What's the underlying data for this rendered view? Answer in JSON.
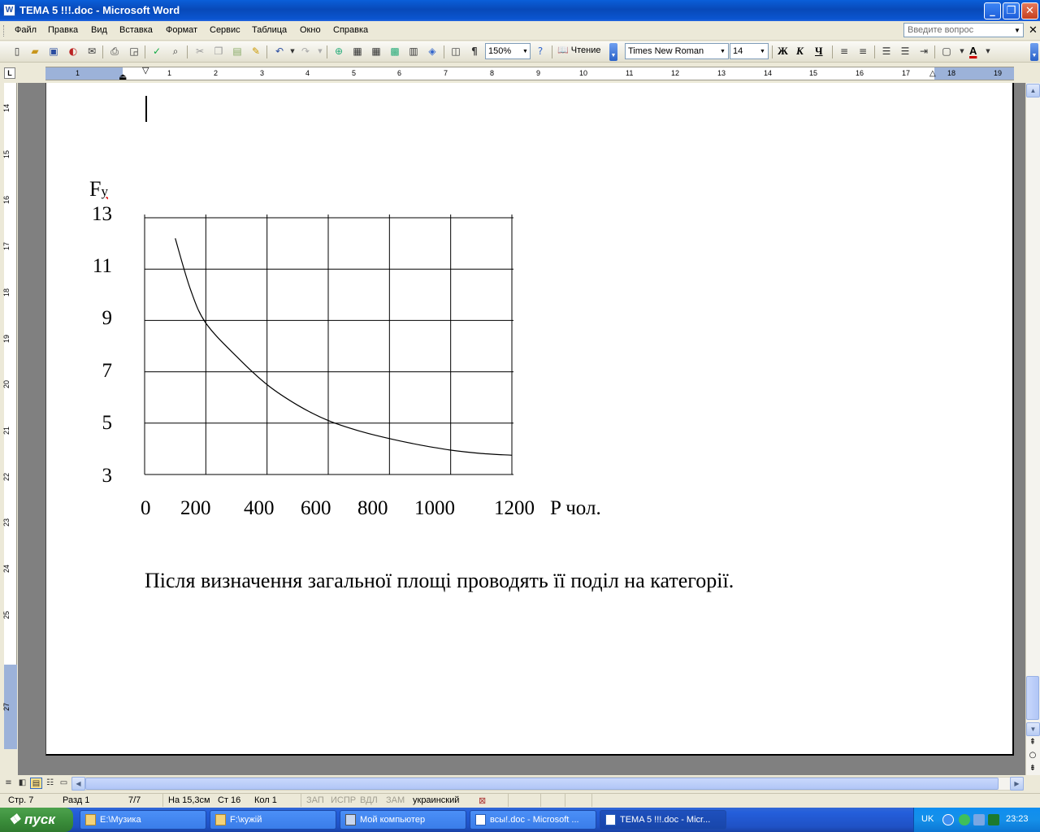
{
  "window": {
    "title": "TEMA 5 !!!.doc - Microsoft Word",
    "icon_glyph": "W",
    "minimize_glyph": "_",
    "restore_glyph": "❐",
    "close_glyph": "✕"
  },
  "menu": {
    "items": [
      "Файл",
      "Правка",
      "Вид",
      "Вставка",
      "Формат",
      "Сервис",
      "Таблица",
      "Окно",
      "Справка"
    ],
    "help_placeholder": "Введите вопрос",
    "close_glyph": "✕"
  },
  "toolbar": {
    "zoom": "150%",
    "read_label": "Чтение",
    "font_name": "Times New Roman",
    "font_size": "14",
    "bold": "Ж",
    "italic": "К",
    "underline": "Ч",
    "font_color_letter": "A"
  },
  "ruler": {
    "corner": "L",
    "h_numbers": [
      "1",
      "1",
      "2",
      "3",
      "4",
      "5",
      "6",
      "7",
      "8",
      "9",
      "10",
      "11",
      "12",
      "13",
      "14",
      "15",
      "16",
      "17",
      "18",
      "19"
    ],
    "v_numbers": [
      "14",
      "15",
      "16",
      "17",
      "18",
      "19",
      "20",
      "21",
      "22",
      "23",
      "24",
      "25",
      "27"
    ]
  },
  "document": {
    "chart_ylabel": "F",
    "chart_ylabel_sub": "y",
    "chart_xlabel": "P чол.",
    "body_text": "Після визначення загальної площі проводять її поділ на категорії."
  },
  "chart_data": {
    "type": "line",
    "xlabel": "P чол.",
    "ylabel": "Fy",
    "x_ticks": [
      "0",
      "200",
      "400",
      "600",
      "800",
      "1000",
      "1200"
    ],
    "y_ticks": [
      "13",
      "11",
      "9",
      "7",
      "5",
      "3"
    ],
    "xlim": [
      0,
      1200
    ],
    "ylim": [
      3,
      13
    ],
    "grid": true,
    "series": [
      {
        "x": [
          100,
          150,
          200,
          300,
          400,
          500,
          600,
          700,
          800,
          900,
          1000,
          1100,
          1200
        ],
        "values": [
          12.2,
          10.2,
          8.9,
          7.6,
          6.5,
          5.7,
          5.1,
          4.7,
          4.4,
          4.15,
          3.95,
          3.82,
          3.75
        ]
      }
    ]
  },
  "statusbar": {
    "page": "Стр. 7",
    "section": "Разд 1",
    "pages": "7/7",
    "position": "На 15,3см",
    "line": "Ст 16",
    "column": "Кол 1",
    "rec": "ЗАП",
    "trk": "ИСПР",
    "ext": "ВДЛ",
    "ovr": "ЗАМ",
    "language": "украинский"
  },
  "taskbar": {
    "start_label": "пуск",
    "tasks": [
      {
        "label": "E:\\Музика",
        "icon": "folder-icon"
      },
      {
        "label": "F:\\кужій",
        "icon": "folder-icon"
      },
      {
        "label": "Мой компьютер",
        "icon": "computer-icon"
      },
      {
        "label": "всы!.doc - Microsoft ...",
        "icon": "word-doc-icon"
      },
      {
        "label": "TEMA 5 !!!.doc - Micr...",
        "icon": "word-doc-icon"
      }
    ],
    "lang": "UK",
    "clock": "23:23"
  }
}
